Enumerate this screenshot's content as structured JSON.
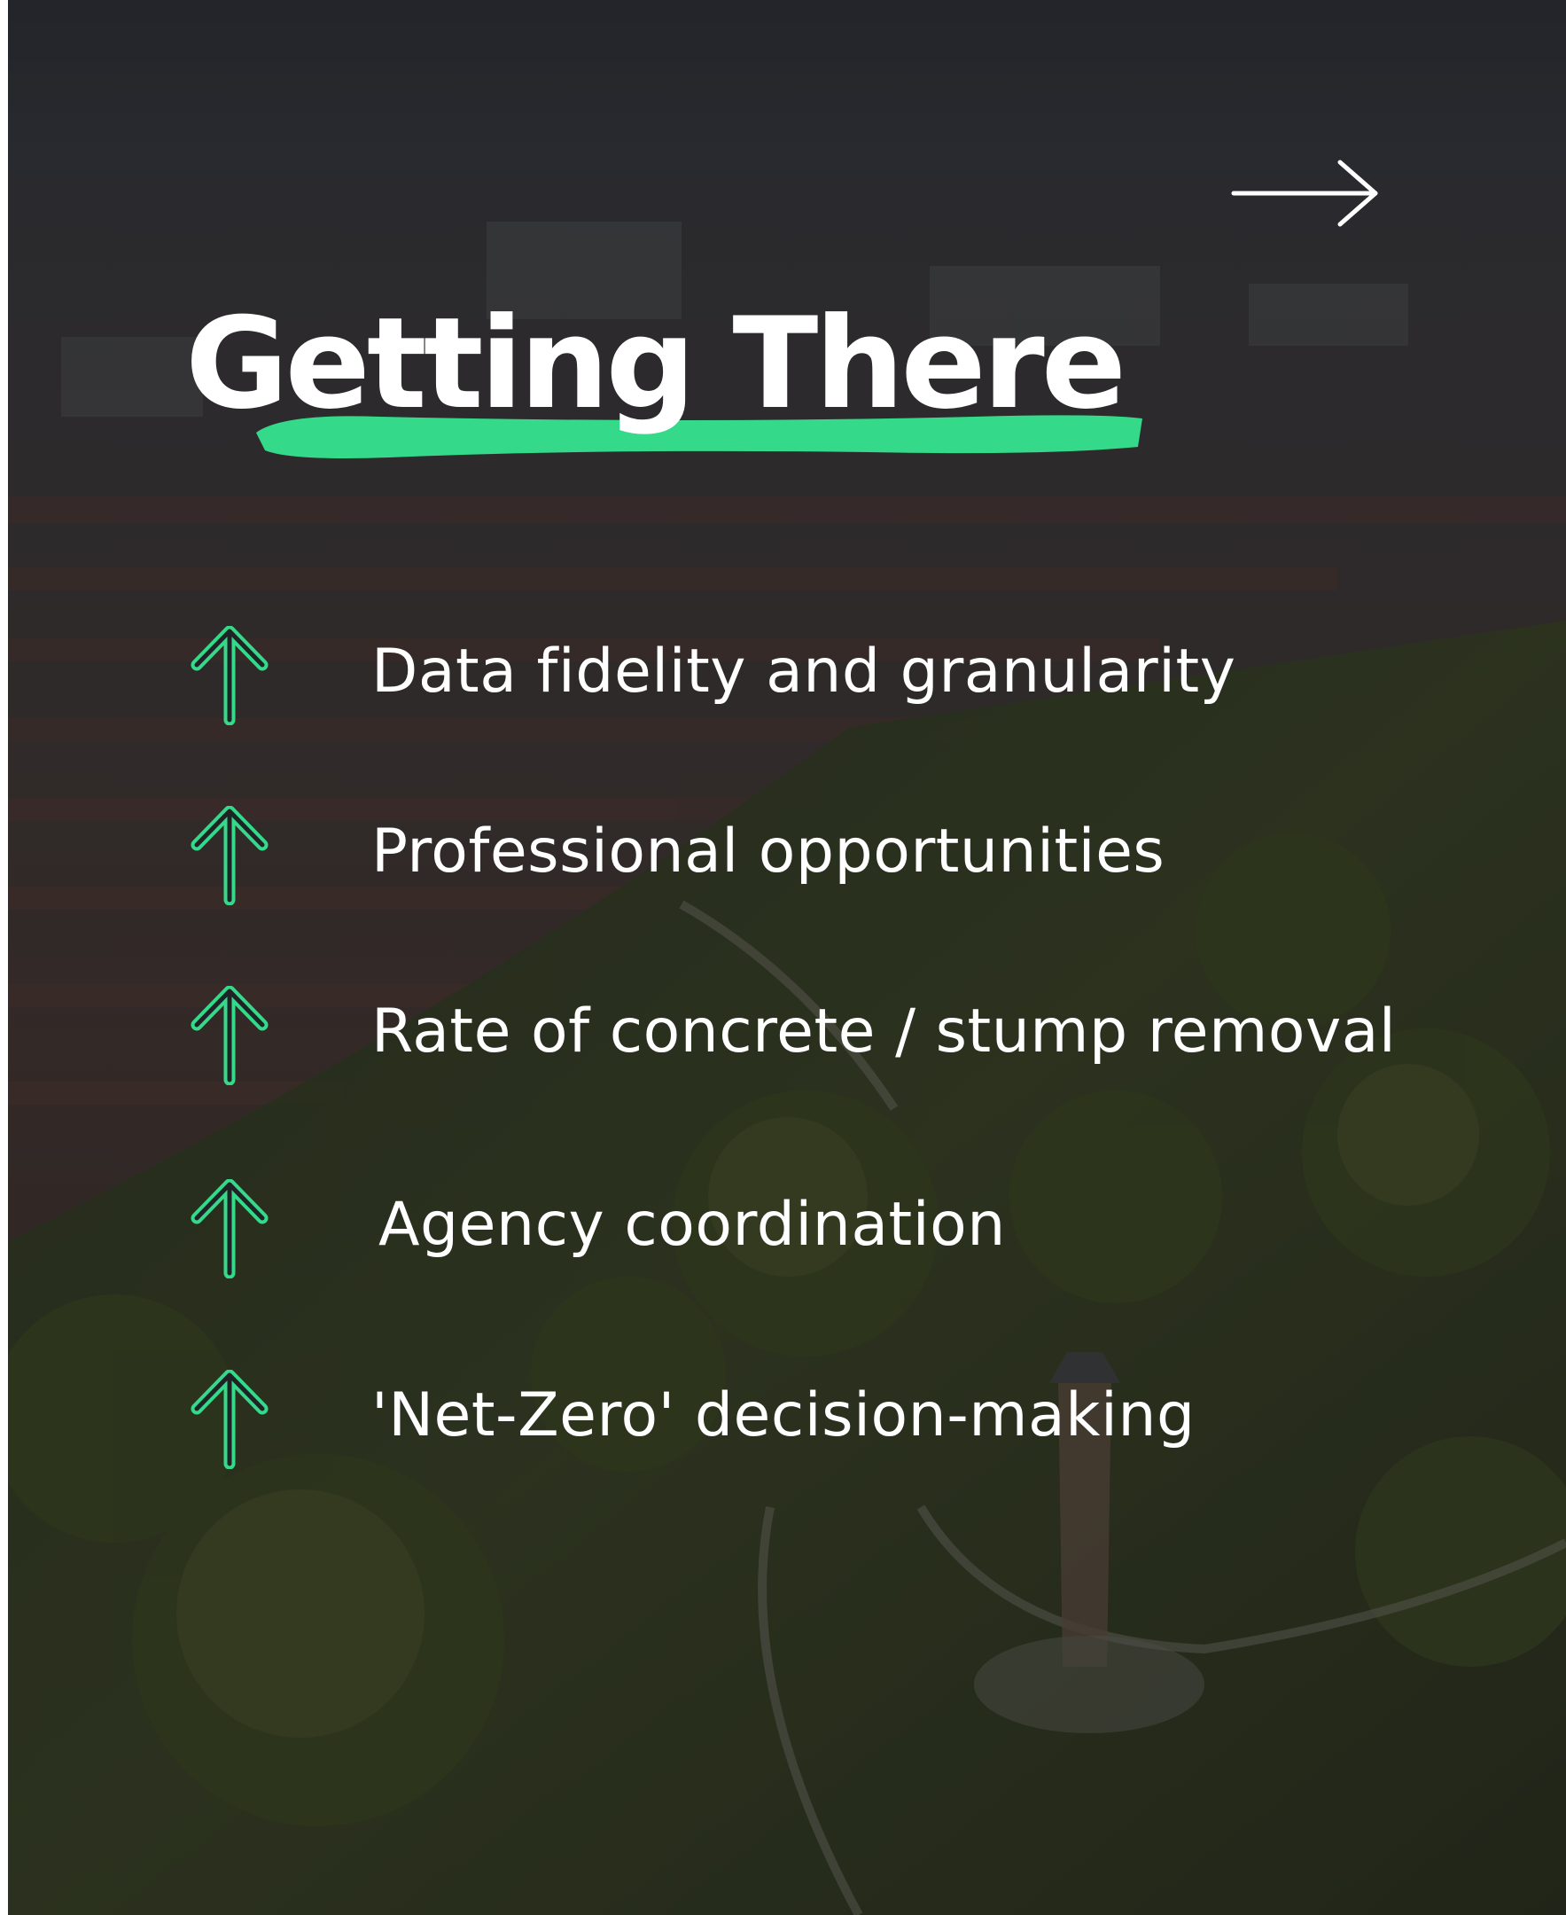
{
  "slide": {
    "title": "Getting There",
    "accent_color": "#34d98a",
    "text_color": "#ffffff",
    "next_icon": "arrow-right-icon",
    "list_icon": "arrow-up-icon",
    "background": "aerial city and park photo"
  },
  "items": [
    {
      "label": "Data fidelity and granularity"
    },
    {
      "label": "Professional opportunities"
    },
    {
      "label": "Rate of concrete / stump removal"
    },
    {
      "label": "Agency coordination"
    },
    {
      "label": "'Net-Zero' decision-making"
    }
  ]
}
